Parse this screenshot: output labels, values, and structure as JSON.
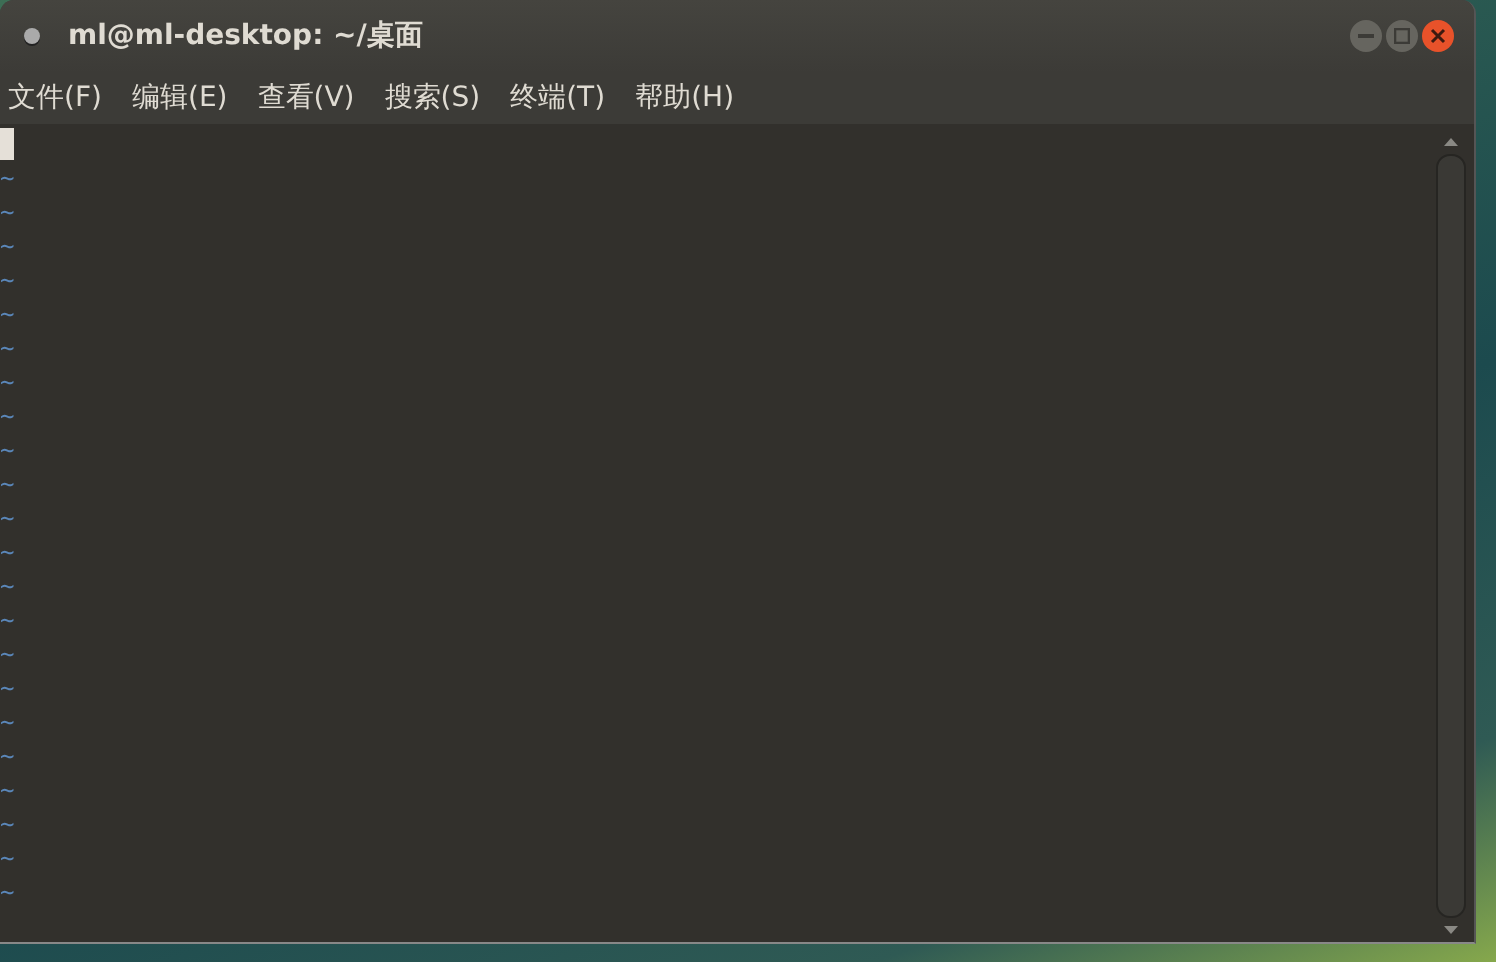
{
  "window": {
    "title": "ml@ml-desktop: ~/桌面"
  },
  "menu": [
    {
      "label": "文件(F)"
    },
    {
      "label": "编辑(E)"
    },
    {
      "label": "查看(V)"
    },
    {
      "label": "搜索(S)"
    },
    {
      "label": "终端(T)"
    },
    {
      "label": "帮助(H)"
    }
  ],
  "terminal": {
    "empty_lines": [
      "~",
      "~",
      "~",
      "~",
      "~",
      "~",
      "~",
      "~",
      "~",
      "~",
      "~",
      "~",
      "~",
      "~",
      "~",
      "~",
      "~",
      "~",
      "~",
      "~",
      "~",
      "~"
    ]
  }
}
